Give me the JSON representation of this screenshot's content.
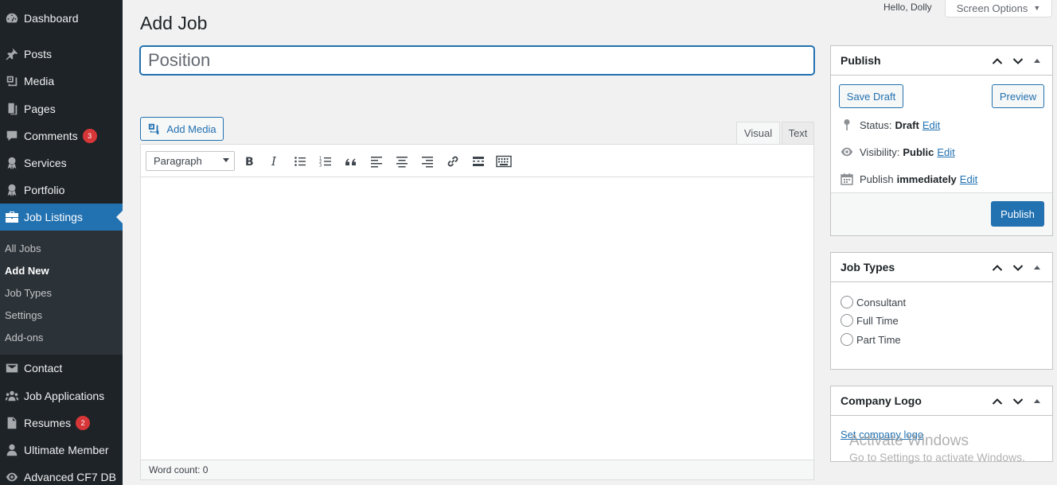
{
  "sidebar": {
    "items": [
      {
        "label": "Dashboard",
        "icon": "dashboard-icon"
      },
      {
        "label": "Posts",
        "icon": "pin-icon"
      },
      {
        "label": "Media",
        "icon": "media-icon"
      },
      {
        "label": "Pages",
        "icon": "pages-icon"
      },
      {
        "label": "Comments",
        "icon": "comment-icon",
        "badge": "3"
      },
      {
        "label": "Services",
        "icon": "award-icon"
      },
      {
        "label": "Portfolio",
        "icon": "award-icon"
      },
      {
        "label": "Job Listings",
        "icon": "briefcase-icon",
        "current": true
      },
      {
        "label": "Contact",
        "icon": "mail-icon"
      },
      {
        "label": "Job Applications",
        "icon": "groups-icon"
      },
      {
        "label": "Resumes",
        "icon": "document-icon",
        "badge": "2"
      },
      {
        "label": "Ultimate Member",
        "icon": "user-icon"
      },
      {
        "label": "Advanced CF7 DB",
        "icon": "eye-icon"
      }
    ],
    "submenu": [
      "All Jobs",
      "Add New",
      "Job Types",
      "Settings",
      "Add-ons"
    ],
    "submenu_active": "Add New"
  },
  "header": {
    "greeting": "Hello, Dolly",
    "screen_options": "Screen Options"
  },
  "main": {
    "page_title": "Add Job",
    "title_placeholder": "Position",
    "add_media": "Add Media",
    "tabs": {
      "visual": "Visual",
      "text": "Text"
    },
    "format_select": "Paragraph",
    "toolbar_icons": [
      "bold-icon",
      "italic-icon",
      "bulleted-list-icon",
      "numbered-list-icon",
      "blockquote-icon",
      "align-left-icon",
      "align-center-icon",
      "align-right-icon",
      "link-icon",
      "read-more-icon",
      "toolbar-toggle-icon"
    ],
    "word_count": "Word count: 0"
  },
  "publish_box": {
    "title": "Publish",
    "save_draft": "Save Draft",
    "preview": "Preview",
    "status_label": "Status:",
    "status_value": "Draft",
    "visibility_label": "Visibility:",
    "visibility_value": "Public",
    "publish_label": "Publish",
    "publish_value": "immediately",
    "edit": "Edit",
    "publish_button": "Publish"
  },
  "job_types_box": {
    "title": "Job Types",
    "options": [
      "Consultant",
      "Full Time",
      "Part Time"
    ]
  },
  "company_logo_box": {
    "title": "Company Logo",
    "link": "Set company logo"
  },
  "watermark": {
    "line1": "Activate Windows",
    "line2": "Go to Settings to activate Windows."
  },
  "colors": {
    "sidebar_bg": "#1d2327",
    "accent": "#2271b1",
    "badge": "#d63638"
  }
}
